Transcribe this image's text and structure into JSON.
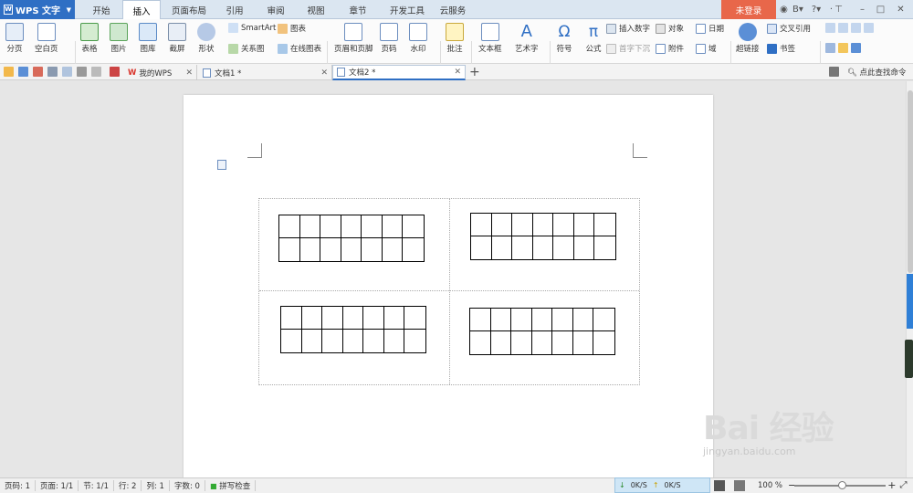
{
  "app": {
    "name": "WPS 文字"
  },
  "menu_tabs": [
    "开始",
    "插入",
    "页面布局",
    "引用",
    "审阅",
    "视图",
    "章节",
    "开发工具",
    "云服务"
  ],
  "active_tab": "插入",
  "login_label": "未登录",
  "ribbon": {
    "page_break": "分页",
    "blank_page": "空白页",
    "table": "表格",
    "picture": "图片",
    "gallery": "图库",
    "screenshot": "截屏",
    "shapes": "形状",
    "smartart": "SmartArt",
    "chart": "图表",
    "relation_chart": "关系图",
    "online_chart": "在线图表",
    "header_footer": "页眉和页脚",
    "page_number": "页码",
    "watermark": "水印",
    "comment": "批注",
    "text_box": "文本框",
    "art_text": "艺术字",
    "symbol": "符号",
    "formula": "公式",
    "insert_number": "插入数字",
    "object": "对象",
    "date": "日期",
    "drop_cap": "首字下沉",
    "attachment": "附件",
    "field": "域",
    "hyperlink": "超链接",
    "cross_ref": "交叉引用",
    "bookmark": "书签"
  },
  "doc_tabs": [
    {
      "label": "我的WPS"
    },
    {
      "label": "文档1 *"
    },
    {
      "label": "文档2 *"
    }
  ],
  "find_command": "点此查找命令",
  "document": {
    "grid_cols": 7,
    "grid_rows": 2,
    "table_count": 4
  },
  "watermark": {
    "brand": "Bai 经验",
    "url": "jingyan.baidu.com"
  },
  "status": {
    "page_no": "页码: 1",
    "pages": "页面: 1/1",
    "section": "节: 1/1",
    "row": "行: 2",
    "col": "列: 1",
    "word_count": "字数: 0",
    "spell_check": "拼写检查",
    "net_down": "0K/S",
    "net_up": "0K/S",
    "zoom": "100 %"
  },
  "colors": {
    "accent": "#2f6fc4",
    "login": "#e8674a"
  }
}
